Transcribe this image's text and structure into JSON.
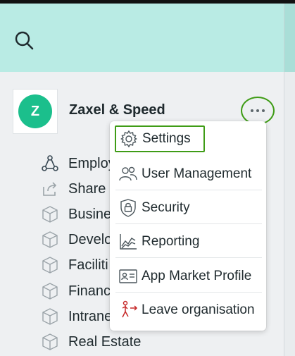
{
  "colors": {
    "header_bg": "#b9ebe4",
    "accent_green": "#3f9c16",
    "logo_green": "#1bbf8c",
    "danger_red": "#c62828"
  },
  "header": {
    "search_icon": "search-icon"
  },
  "org": {
    "logo_letter": "Z",
    "name": "Zaxel & Speed"
  },
  "nav": {
    "items": [
      {
        "label": "Employ",
        "icon": "hierarchy-icon"
      },
      {
        "label": "Share",
        "icon": "share-icon"
      },
      {
        "label": "Busine",
        "icon": "cube-icon"
      },
      {
        "label": "Develo",
        "icon": "cube-icon"
      },
      {
        "label": "Faciliti",
        "icon": "cube-icon"
      },
      {
        "label": "Financ",
        "icon": "cube-icon"
      },
      {
        "label": "Intrane",
        "icon": "cube-icon"
      },
      {
        "label": "Real Estate",
        "icon": "cube-icon"
      }
    ]
  },
  "menu": {
    "items": [
      {
        "label": "Settings",
        "icon": "gear-icon"
      },
      {
        "label": "User Management",
        "icon": "users-icon"
      },
      {
        "label": "Security",
        "icon": "lock-shield-icon"
      },
      {
        "label": "Reporting",
        "icon": "chart-icon"
      },
      {
        "label": "App Market Profile",
        "icon": "profile-card-icon"
      },
      {
        "label": "Leave organisation",
        "icon": "leave-icon"
      }
    ]
  }
}
